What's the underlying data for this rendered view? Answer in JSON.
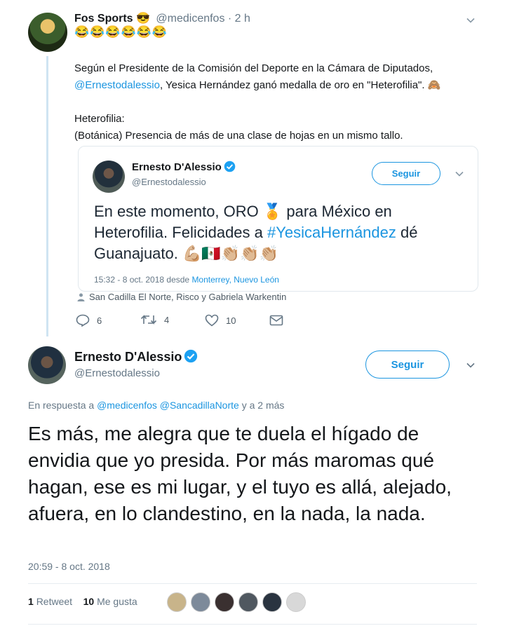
{
  "top_tweet": {
    "name": "Fos Sports 😎",
    "handle": "@medicenfos · 2 h",
    "emojis": "😂😂😂😂😂😂",
    "line1": "Según el Presidente de la Comisión del Deporte en la Cámara de Diputados,",
    "mention": "@Ernestodalessio",
    "line2_rest": ",  Yesica Hernández ganó medalla de oro en \"Heterofilia\". 🙈",
    "line3": "Heterofilia:",
    "line4": "(Botánica) Presencia de más de una clase de hojas en un mismo tallo."
  },
  "quoted_tweet": {
    "name": "Ernesto D'Alessio",
    "handle": "@Ernestodalessio",
    "follow_label": "Seguir",
    "text_start": "En este momento, ORO 🏅 para México en Heterofilia. Felicidades a ",
    "hashtag": "#YesicaHernández",
    "text_end": " dé Guanajuato. 💪🏼🇲🇽👏🏼👏🏼👏🏼",
    "meta_prefix": "15:32 - 8 oct. 2018 desde ",
    "location": "Monterrey, Nuevo León"
  },
  "tagged": "San Cadilla El Norte, Risco y Gabriela Warkentin",
  "actions": {
    "replies": "6",
    "retweets": "4",
    "likes": "10"
  },
  "reply_tweet": {
    "name": "Ernesto D'Alessio",
    "handle": "@Ernestodalessio",
    "follow_label": "Seguir",
    "in_reply_prefix": "En respuesta a ",
    "in_reply_mentions": "@medicenfos @SancadillaNorte",
    "in_reply_suffix": " y a 2 más",
    "text": "Es más, me alegra que te duela el hígado de envidia que yo presida. Por más maromas qué hagan, ese es mi lugar, y el tuyo es allá, alejado, afuera, en lo clandestino, en la nada, la nada.",
    "timestamp": "20:59 - 8 oct. 2018",
    "retweet_count": "1",
    "retweet_label": "Retweet",
    "like_count": "10",
    "like_label": "Me gusta"
  },
  "colors": {
    "link": "#1b95e0",
    "verified": "#1da1f2",
    "muted": "#657786"
  }
}
